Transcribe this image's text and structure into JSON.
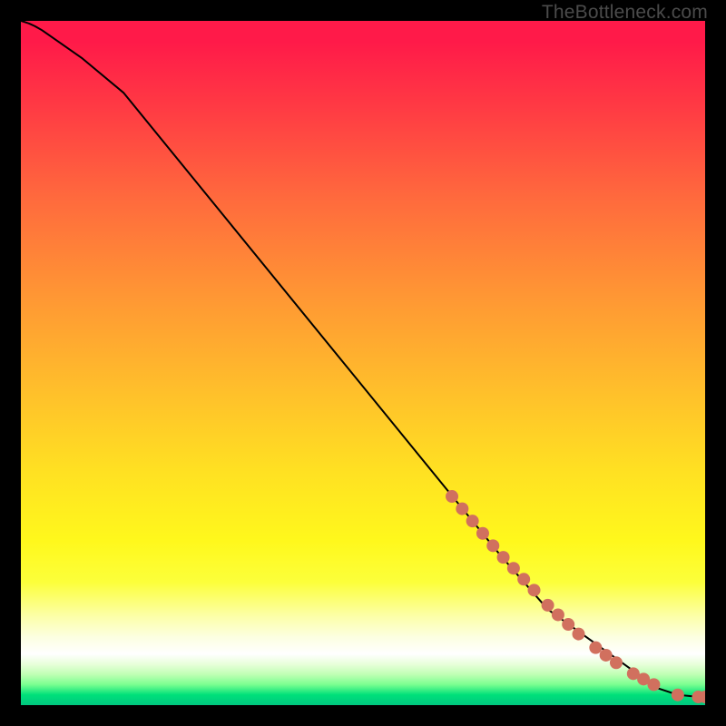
{
  "watermark": "TheBottleneck.com",
  "chart_data": {
    "type": "line",
    "title": "",
    "xlabel": "",
    "ylabel": "",
    "xlim": [
      0,
      100
    ],
    "ylim": [
      0,
      100
    ],
    "grid": false,
    "series": [
      {
        "name": "curve",
        "x": [
          0,
          4,
          9,
          15,
          70,
          77,
          93,
          96,
          99,
          100
        ],
        "y": [
          100,
          98,
          94.5,
          89.5,
          22,
          14,
          2.5,
          1.5,
          1.2,
          1.2
        ],
        "stroke": "#000000",
        "marker": false
      },
      {
        "name": "highlight-points",
        "x": [
          63,
          64.5,
          66,
          67.5,
          69,
          70.5,
          72,
          73.5,
          75,
          77,
          78.5,
          80,
          81.5,
          84,
          85.5,
          87,
          89.5,
          91,
          92.5,
          96,
          99,
          100
        ],
        "y": [
          30.5,
          28.7,
          26.9,
          25.1,
          23.3,
          21.6,
          20.0,
          18.4,
          16.8,
          14.6,
          13.2,
          11.8,
          10.4,
          8.4,
          7.3,
          6.2,
          4.6,
          3.8,
          3.0,
          1.5,
          1.2,
          1.2
        ],
        "stroke": "none",
        "marker": true,
        "marker_color": "#d1705e",
        "marker_radius_px": 7
      }
    ]
  }
}
